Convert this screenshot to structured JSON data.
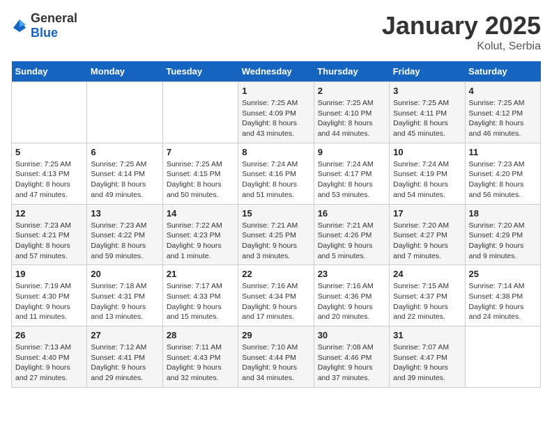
{
  "header": {
    "logo_general": "General",
    "logo_blue": "Blue",
    "title": "January 2025",
    "subtitle": "Kolut, Serbia"
  },
  "weekdays": [
    "Sunday",
    "Monday",
    "Tuesday",
    "Wednesday",
    "Thursday",
    "Friday",
    "Saturday"
  ],
  "weeks": [
    [
      {
        "day": "",
        "info": ""
      },
      {
        "day": "",
        "info": ""
      },
      {
        "day": "",
        "info": ""
      },
      {
        "day": "1",
        "info": "Sunrise: 7:25 AM\nSunset: 4:09 PM\nDaylight: 8 hours and 43 minutes."
      },
      {
        "day": "2",
        "info": "Sunrise: 7:25 AM\nSunset: 4:10 PM\nDaylight: 8 hours and 44 minutes."
      },
      {
        "day": "3",
        "info": "Sunrise: 7:25 AM\nSunset: 4:11 PM\nDaylight: 8 hours and 45 minutes."
      },
      {
        "day": "4",
        "info": "Sunrise: 7:25 AM\nSunset: 4:12 PM\nDaylight: 8 hours and 46 minutes."
      }
    ],
    [
      {
        "day": "5",
        "info": "Sunrise: 7:25 AM\nSunset: 4:13 PM\nDaylight: 8 hours and 47 minutes."
      },
      {
        "day": "6",
        "info": "Sunrise: 7:25 AM\nSunset: 4:14 PM\nDaylight: 8 hours and 49 minutes."
      },
      {
        "day": "7",
        "info": "Sunrise: 7:25 AM\nSunset: 4:15 PM\nDaylight: 8 hours and 50 minutes."
      },
      {
        "day": "8",
        "info": "Sunrise: 7:24 AM\nSunset: 4:16 PM\nDaylight: 8 hours and 51 minutes."
      },
      {
        "day": "9",
        "info": "Sunrise: 7:24 AM\nSunset: 4:17 PM\nDaylight: 8 hours and 53 minutes."
      },
      {
        "day": "10",
        "info": "Sunrise: 7:24 AM\nSunset: 4:19 PM\nDaylight: 8 hours and 54 minutes."
      },
      {
        "day": "11",
        "info": "Sunrise: 7:23 AM\nSunset: 4:20 PM\nDaylight: 8 hours and 56 minutes."
      }
    ],
    [
      {
        "day": "12",
        "info": "Sunrise: 7:23 AM\nSunset: 4:21 PM\nDaylight: 8 hours and 57 minutes."
      },
      {
        "day": "13",
        "info": "Sunrise: 7:23 AM\nSunset: 4:22 PM\nDaylight: 8 hours and 59 minutes."
      },
      {
        "day": "14",
        "info": "Sunrise: 7:22 AM\nSunset: 4:23 PM\nDaylight: 9 hours and 1 minute."
      },
      {
        "day": "15",
        "info": "Sunrise: 7:21 AM\nSunset: 4:25 PM\nDaylight: 9 hours and 3 minutes."
      },
      {
        "day": "16",
        "info": "Sunrise: 7:21 AM\nSunset: 4:26 PM\nDaylight: 9 hours and 5 minutes."
      },
      {
        "day": "17",
        "info": "Sunrise: 7:20 AM\nSunset: 4:27 PM\nDaylight: 9 hours and 7 minutes."
      },
      {
        "day": "18",
        "info": "Sunrise: 7:20 AM\nSunset: 4:29 PM\nDaylight: 9 hours and 9 minutes."
      }
    ],
    [
      {
        "day": "19",
        "info": "Sunrise: 7:19 AM\nSunset: 4:30 PM\nDaylight: 9 hours and 11 minutes."
      },
      {
        "day": "20",
        "info": "Sunrise: 7:18 AM\nSunset: 4:31 PM\nDaylight: 9 hours and 13 minutes."
      },
      {
        "day": "21",
        "info": "Sunrise: 7:17 AM\nSunset: 4:33 PM\nDaylight: 9 hours and 15 minutes."
      },
      {
        "day": "22",
        "info": "Sunrise: 7:16 AM\nSunset: 4:34 PM\nDaylight: 9 hours and 17 minutes."
      },
      {
        "day": "23",
        "info": "Sunrise: 7:16 AM\nSunset: 4:36 PM\nDaylight: 9 hours and 20 minutes."
      },
      {
        "day": "24",
        "info": "Sunrise: 7:15 AM\nSunset: 4:37 PM\nDaylight: 9 hours and 22 minutes."
      },
      {
        "day": "25",
        "info": "Sunrise: 7:14 AM\nSunset: 4:38 PM\nDaylight: 9 hours and 24 minutes."
      }
    ],
    [
      {
        "day": "26",
        "info": "Sunrise: 7:13 AM\nSunset: 4:40 PM\nDaylight: 9 hours and 27 minutes."
      },
      {
        "day": "27",
        "info": "Sunrise: 7:12 AM\nSunset: 4:41 PM\nDaylight: 9 hours and 29 minutes."
      },
      {
        "day": "28",
        "info": "Sunrise: 7:11 AM\nSunset: 4:43 PM\nDaylight: 9 hours and 32 minutes."
      },
      {
        "day": "29",
        "info": "Sunrise: 7:10 AM\nSunset: 4:44 PM\nDaylight: 9 hours and 34 minutes."
      },
      {
        "day": "30",
        "info": "Sunrise: 7:08 AM\nSunset: 4:46 PM\nDaylight: 9 hours and 37 minutes."
      },
      {
        "day": "31",
        "info": "Sunrise: 7:07 AM\nSunset: 4:47 PM\nDaylight: 9 hours and 39 minutes."
      },
      {
        "day": "",
        "info": ""
      }
    ]
  ]
}
